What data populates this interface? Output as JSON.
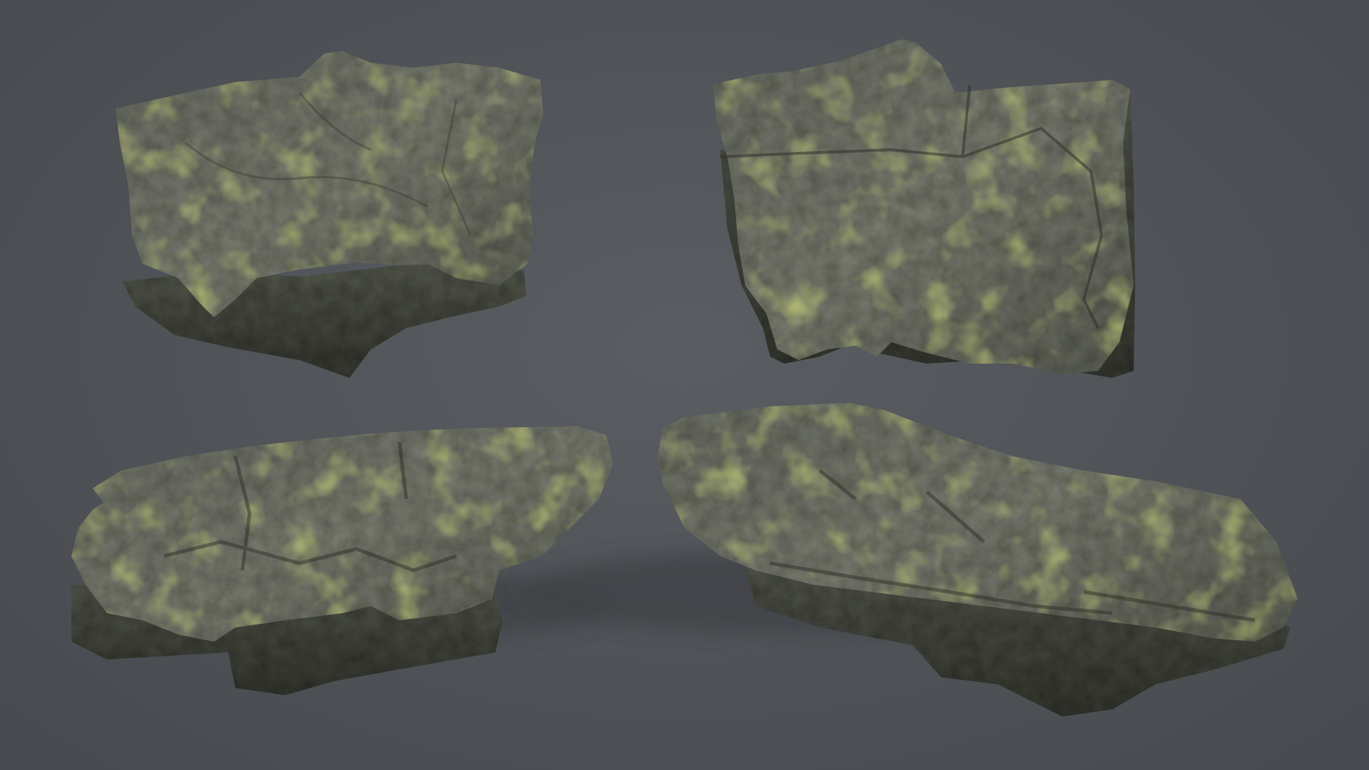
{
  "scene": {
    "background_color": "#505358",
    "rock_base_color": "#5f6356",
    "rock_shadow_color": "#2e3029",
    "rock_highlight_color": "#8a8d80",
    "moss_color": "#7f8a32",
    "rocks": [
      {
        "name": "rock-top-left",
        "view": "top"
      },
      {
        "name": "rock-top-right",
        "view": "top"
      },
      {
        "name": "rock-bottom-left",
        "view": "side"
      },
      {
        "name": "rock-bottom-right",
        "view": "side"
      }
    ]
  }
}
